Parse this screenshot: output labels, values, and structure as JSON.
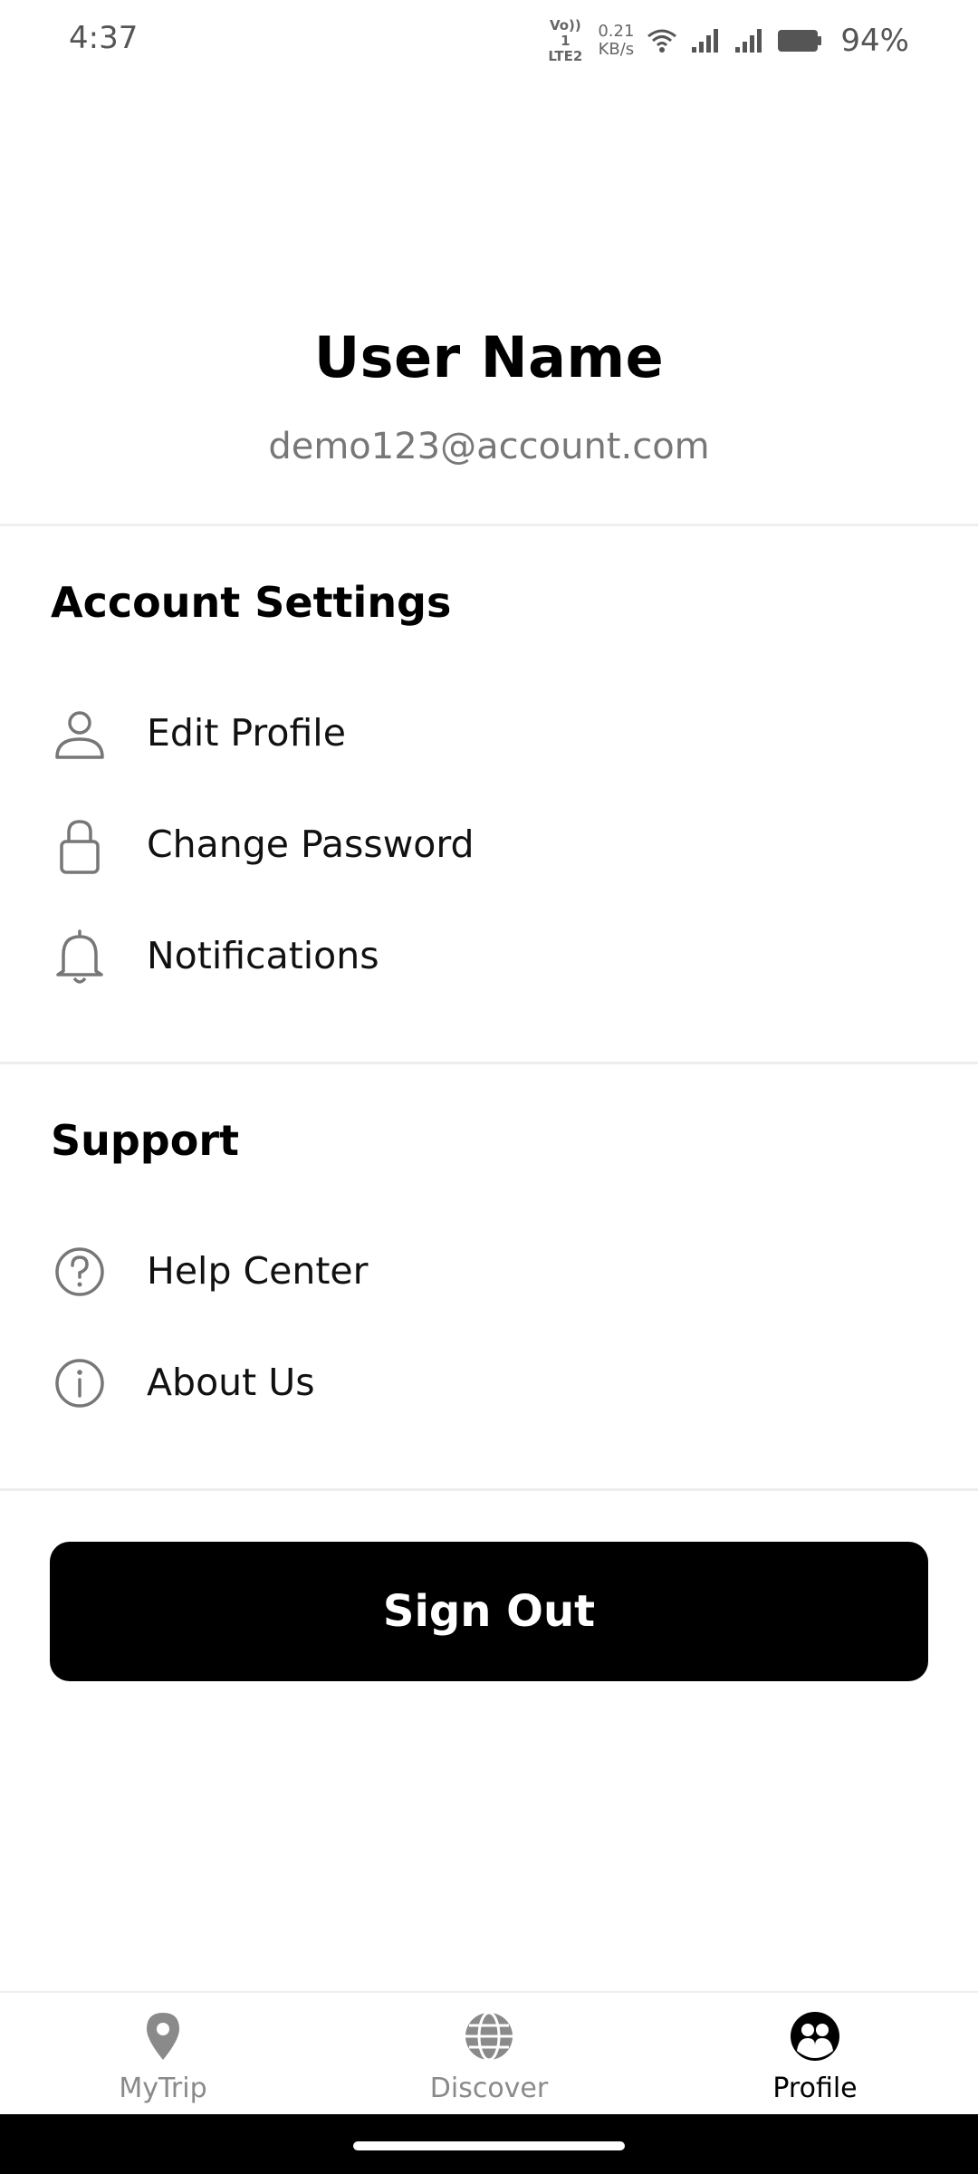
{
  "status_bar": {
    "time": "4:37",
    "network_tag": "Vo)) 1 LTE2",
    "speed_value": "0.21",
    "speed_unit": "KB/s",
    "battery": "94%"
  },
  "profile": {
    "name": "User Name",
    "email": "demo123@account.com"
  },
  "account_settings": {
    "title": "Account Settings",
    "items": [
      {
        "label": "Edit Profile",
        "icon": "person-icon"
      },
      {
        "label": "Change Password",
        "icon": "lock-icon"
      },
      {
        "label": "Notifications",
        "icon": "bell-icon"
      }
    ]
  },
  "support": {
    "title": "Support",
    "items": [
      {
        "label": "Help Center",
        "icon": "question-circle-icon"
      },
      {
        "label": "About Us",
        "icon": "info-circle-icon"
      }
    ]
  },
  "sign_out_label": "Sign Out",
  "bottom_nav": {
    "items": [
      {
        "label": "MyTrip",
        "icon": "location-pin-icon",
        "active": false
      },
      {
        "label": "Discover",
        "icon": "globe-icon",
        "active": false
      },
      {
        "label": "Profile",
        "icon": "profile-group-icon",
        "active": true
      }
    ]
  },
  "colors": {
    "background": "#ffffff",
    "primary": "#000000",
    "muted_text": "#777777",
    "inactive_nav": "#8a8a8a",
    "divider": "#eeeeee"
  }
}
